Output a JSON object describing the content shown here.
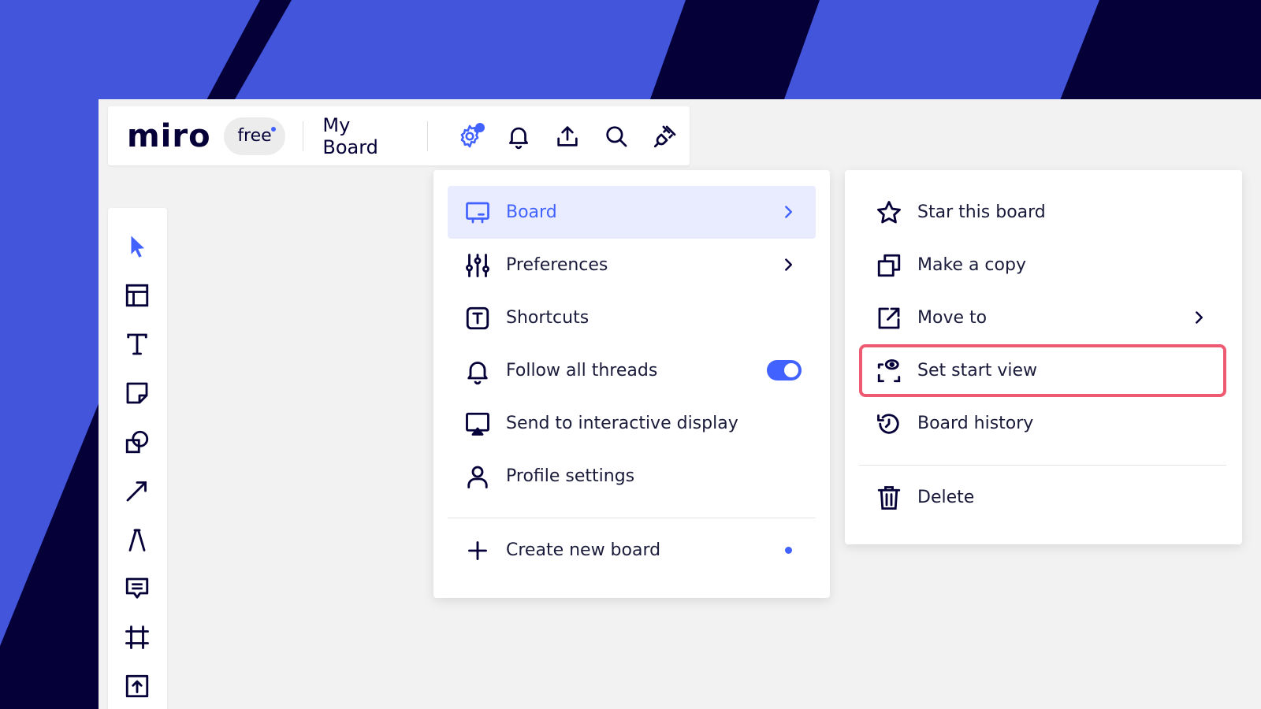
{
  "colors": {
    "background_blue": "#4255db",
    "stripe_navy": "#050038",
    "accent": "#4262ff",
    "highlight_border": "#ee5a72",
    "active_item_bg": "#e9ebff"
  },
  "topbar": {
    "logo": "miro",
    "plan_badge": "free",
    "board_name": "My Board",
    "icons": [
      "settings-gear-icon",
      "bell-icon",
      "upload-icon",
      "search-icon",
      "plug-icon"
    ]
  },
  "toolbar": {
    "tools": [
      "select-cursor-icon",
      "templates-icon",
      "text-icon",
      "sticky-note-icon",
      "shapes-icon",
      "arrow-line-icon",
      "pen-icon",
      "comment-icon",
      "frame-icon",
      "upload-icon"
    ]
  },
  "menu": {
    "items": [
      {
        "label": "Board",
        "icon": "board-icon",
        "active": true,
        "has_submenu": true
      },
      {
        "label": "Preferences",
        "icon": "sliders-icon",
        "has_submenu": true
      },
      {
        "label": "Shortcuts",
        "icon": "keyboard-key-icon"
      },
      {
        "label": "Follow all threads",
        "icon": "bell-icon",
        "toggle_on": true
      },
      {
        "label": "Send to interactive display",
        "icon": "display-icon"
      },
      {
        "label": "Profile settings",
        "icon": "person-icon"
      },
      {
        "label": "Create new board",
        "icon": "plus-icon",
        "new_indicator": true
      }
    ]
  },
  "submenu": {
    "items": [
      {
        "label": "Star this board",
        "icon": "star-icon"
      },
      {
        "label": "Make a copy",
        "icon": "copy-icon"
      },
      {
        "label": "Move to",
        "icon": "move-to-icon",
        "has_submenu": true
      },
      {
        "label": "Set start view",
        "icon": "start-view-icon",
        "highlighted": true
      },
      {
        "label": "Board history",
        "icon": "history-icon"
      },
      {
        "label": "Delete",
        "icon": "trash-icon"
      }
    ]
  }
}
